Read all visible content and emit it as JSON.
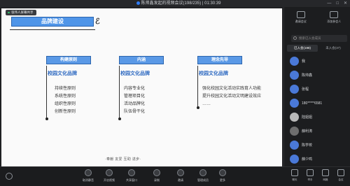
{
  "window": {
    "title": "陈帅鑫发起的视频会议(198/235) | 01:30:39",
    "minimize": "—",
    "maximize": "□",
    "close": "✕"
  },
  "slide": {
    "share_tag": "张伟人屏幕共享",
    "title": "品牌建设",
    "columns": [
      {
        "head": "构建原则",
        "subtitle": "校园文化品牌",
        "items": [
          "持续性原则",
          "系统性原则",
          "组织性原则",
          "创新性原则"
        ]
      },
      {
        "head": "内涵",
        "subtitle": "校园文化品牌",
        "items": [
          "内容专业化",
          "管理项目化",
          "活动品牌化",
          "队伍骨干化"
        ]
      },
      {
        "head": "理念先导",
        "subtitle": "校园文化品牌",
        "items": [
          "强化校园文化活动实践育人功能",
          "提升校园文化活动文明建设效应",
          "……"
        ]
      }
    ],
    "footer": "·奉献  友爱  互助  进步·"
  },
  "panel": {
    "actions": [
      {
        "label": "邀请会议"
      },
      {
        "label": "添加参会人"
      }
    ],
    "search_placeholder": "搜索已入会成员",
    "tabs": [
      "已入会(198)",
      "未入会(37)"
    ],
    "participants": [
      "我",
      "陈帅鑫",
      "张程",
      "180*****6581",
      "陆姐姐",
      "薛利涛",
      "陈学校",
      "薛少鸣"
    ]
  },
  "toolbar": {
    "buttons": [
      "取消静音",
      "开启视频",
      "共享窗口",
      "录制",
      "邀请",
      "管理成员",
      "更多"
    ],
    "right_buttons": [
      "聊天",
      "举手",
      "网格",
      "会议"
    ]
  }
}
